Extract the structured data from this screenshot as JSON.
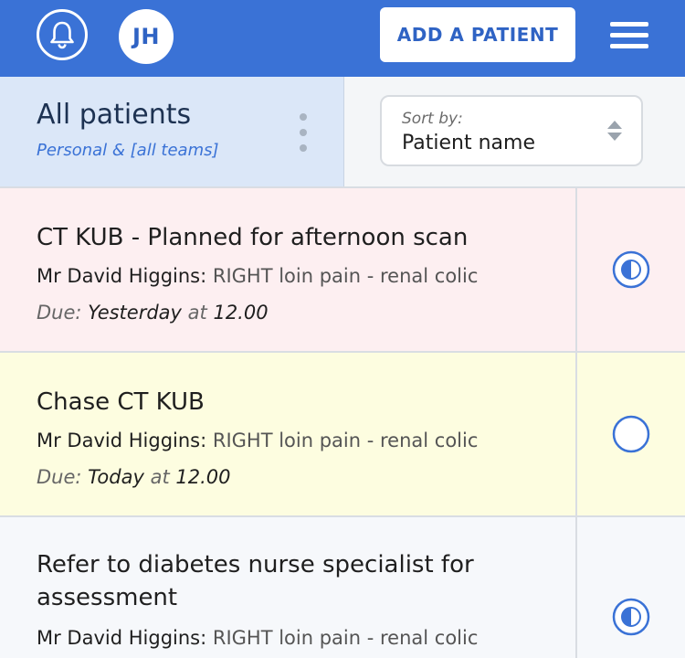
{
  "topbar": {
    "avatar_initials": "JH",
    "add_button_label": "ADD A PATIENT",
    "icons": {
      "notifications": "bell-icon",
      "menu": "hamburger-menu-icon"
    }
  },
  "header": {
    "title": "All patients",
    "subtitle": "Personal & [all teams]",
    "sort": {
      "label": "Sort by:",
      "value": "Patient name"
    }
  },
  "tasks": [
    {
      "title": "CT KUB - Planned for afternoon scan",
      "patient": "Mr David Higgins:",
      "condition": "RIGHT loin pain - renal colic",
      "due_label": "Due:",
      "due_day": "Yesterday",
      "due_at": "at",
      "due_time": "12.00",
      "status": "half",
      "background": "#fdeff1"
    },
    {
      "title": "Chase CT KUB",
      "patient": "Mr David Higgins:",
      "condition": "RIGHT loin pain - renal colic",
      "due_label": "Due:",
      "due_day": "Today",
      "due_at": "at",
      "due_time": "12.00",
      "status": "empty",
      "background": "#fdfde0"
    },
    {
      "title": "Refer to diabetes nurse specialist for assessment",
      "patient": "Mr David Higgins:",
      "condition": "RIGHT loin pain - renal colic",
      "status": "half",
      "background": "#f6f8fb"
    }
  ],
  "colors": {
    "accent": "#3a72d6",
    "header_panel": "#dbe7f8"
  }
}
